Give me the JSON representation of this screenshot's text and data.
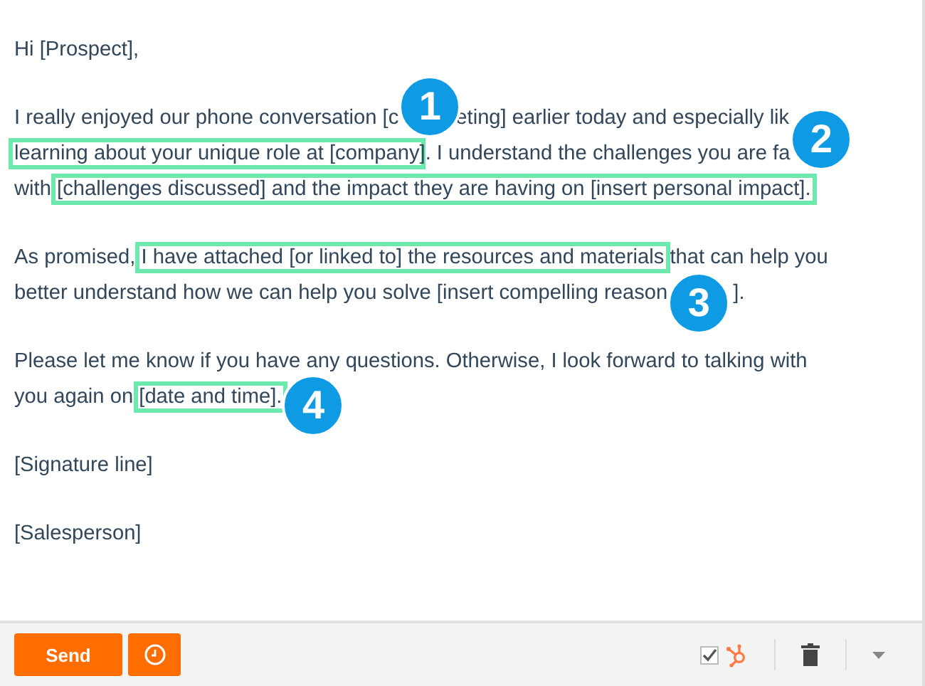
{
  "paragraphs": [
    {
      "lines": [
        [
          {
            "kind": "text",
            "text": "Hi [Prospect],"
          }
        ]
      ]
    },
    {
      "lines": [
        [
          {
            "kind": "text",
            "text": "I really enjoyed our phone conversation [c"
          },
          {
            "kind": "badge",
            "text": "1"
          },
          {
            "kind": "text",
            "text": "eting] earlier today and especially lik"
          }
        ],
        [
          {
            "kind": "highlight",
            "text": "learning about your unique role at [company"
          },
          {
            "kind": "text",
            "text": "]. I understand the challenges you are fa"
          },
          {
            "kind": "badge",
            "text": "2"
          }
        ],
        [
          {
            "kind": "text",
            "text": "with "
          },
          {
            "kind": "highlight",
            "text": "[challenges discussed] and the impact they are having on [insert personal impact]."
          }
        ]
      ]
    },
    {
      "lines": [
        [
          {
            "kind": "text",
            "text": "As promised, "
          },
          {
            "kind": "highlight",
            "text": "I have attached [or linked to] the resources and materials"
          },
          {
            "kind": "text",
            "text": " that can help you"
          }
        ],
        [
          {
            "kind": "text",
            "text": "better understand how we can help you solve [insert compelling reason"
          },
          {
            "kind": "badge",
            "text": "3"
          },
          {
            "kind": "text",
            "text": "]."
          }
        ]
      ]
    },
    {
      "lines": [
        [
          {
            "kind": "text",
            "text": "Please let me know if you have any questions. Otherwise, I look forward to talking with"
          }
        ],
        [
          {
            "kind": "text",
            "text": "you again on "
          },
          {
            "kind": "highlight",
            "text": "[date and time]."
          },
          {
            "kind": "badge",
            "text": "4"
          }
        ]
      ]
    },
    {
      "lines": [
        [
          {
            "kind": "text",
            "text": "[Signature line]"
          }
        ]
      ]
    },
    {
      "lines": [
        [
          {
            "kind": "text",
            "text": "[Salesperson]"
          }
        ]
      ]
    }
  ],
  "footer": {
    "send": "Send",
    "log_checkbox": {
      "checked": true
    }
  }
}
